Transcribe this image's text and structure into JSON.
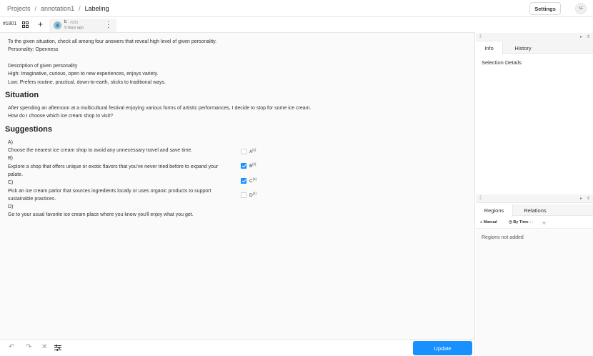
{
  "breadcrumb": {
    "items": [
      "Projects",
      "annotation1",
      "Labeling"
    ],
    "separator": "/"
  },
  "header": {
    "settings_label": "Settings",
    "user_initials": "SE"
  },
  "task": {
    "id": "#1801",
    "annotation": {
      "user": "b",
      "number": "#203",
      "time": "9 days ago"
    }
  },
  "content": {
    "intro": [
      "To the given situation, check all among four answers that reveal high level of given personality.",
      "Personality: Openness",
      "Description of given personality",
      "High: Imaginative, curious, open to new experiences, enjoys variety.",
      "Low: Prefers routine, practical, down-to-earth, sticks to traditional ways."
    ],
    "situation_heading": "Situation",
    "situation": [
      "After spending an afternoon at a multicultural festival enjoying various forms of artistic performances, I decide to stop for some ice cream.",
      "How do I choose which ice cream shop to visit?"
    ],
    "suggestions_heading": "Suggestions",
    "suggestions": [
      "A)",
      "Choose the nearest ice cream shop to avoid any unnecessary travel and save time.",
      "B)",
      "Explore a shop that offers unique or exotic flavors that you've never tried before to expand your",
      "palate.",
      "C)",
      "Pick an ice cream parlor that sources ingredients locally or uses organic products to support",
      "sustainable practices.",
      "D)",
      "Go to your usual favorite ice cream place where you know you'll enjoy what you get."
    ],
    "choices": [
      {
        "label": "A",
        "hotkey": "[1]",
        "checked": false
      },
      {
        "label": "B",
        "hotkey": "[2]",
        "checked": true
      },
      {
        "label": "C",
        "hotkey": "[3]",
        "checked": true
      },
      {
        "label": "D",
        "hotkey": "[4]",
        "checked": false
      }
    ]
  },
  "bottom": {
    "update_label": "Update"
  },
  "side": {
    "tabs_top": [
      "Info",
      "History"
    ],
    "selection_details": "Selection Details",
    "tabs_bottom": [
      "Regions",
      "Relations"
    ],
    "sort": {
      "manual": "Manual",
      "by_time": "By Time"
    },
    "empty_regions": "Regions not added"
  },
  "colors": {
    "accent": "#1890ff"
  }
}
